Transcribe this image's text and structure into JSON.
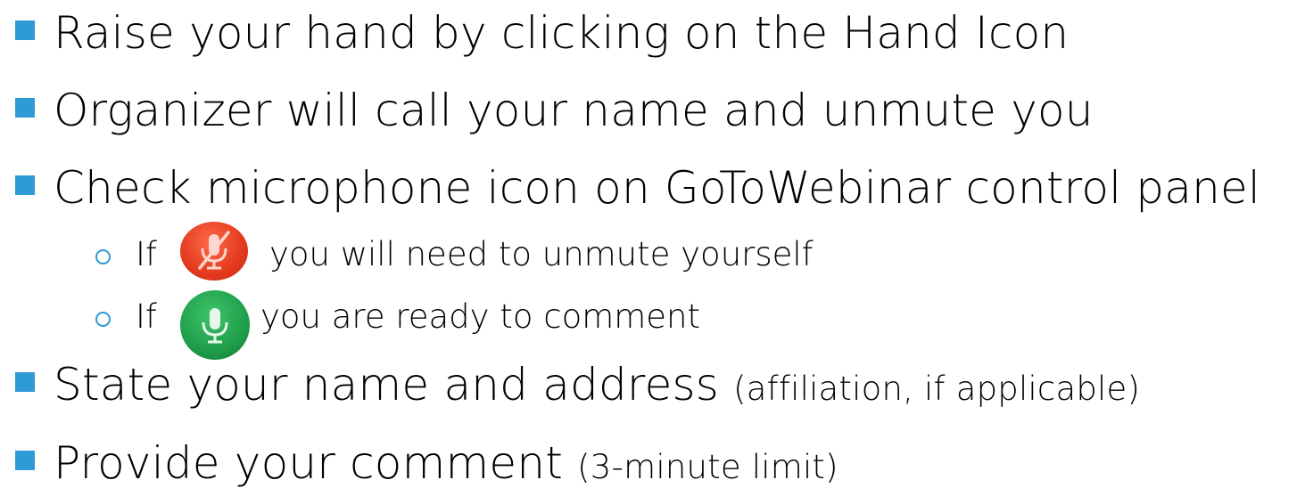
{
  "bullets": [
    {
      "text": "Raise your hand by clicking on the Hand Icon",
      "note": ""
    },
    {
      "text": "Organizer will call your name and unmute you",
      "note": ""
    },
    {
      "text": "Check microphone icon on GoToWebinar control panel",
      "note": ""
    }
  ],
  "sub_bullets": [
    {
      "prefix": "If",
      "text": "you will need to unmute yourself",
      "icon": "muted-microphone-icon",
      "color": "#e8452c"
    },
    {
      "prefix": "If",
      "text": "you are ready to comment",
      "icon": "microphone-icon",
      "color": "#1f9e4a"
    }
  ],
  "bullets_after": [
    {
      "text": "State your name and address ",
      "note": "(affiliation, if applicable)"
    },
    {
      "text": "Provide your comment ",
      "note": "(3-minute limit)"
    }
  ],
  "colors": {
    "bullet": "#2e9ad6",
    "text": "#000000"
  }
}
